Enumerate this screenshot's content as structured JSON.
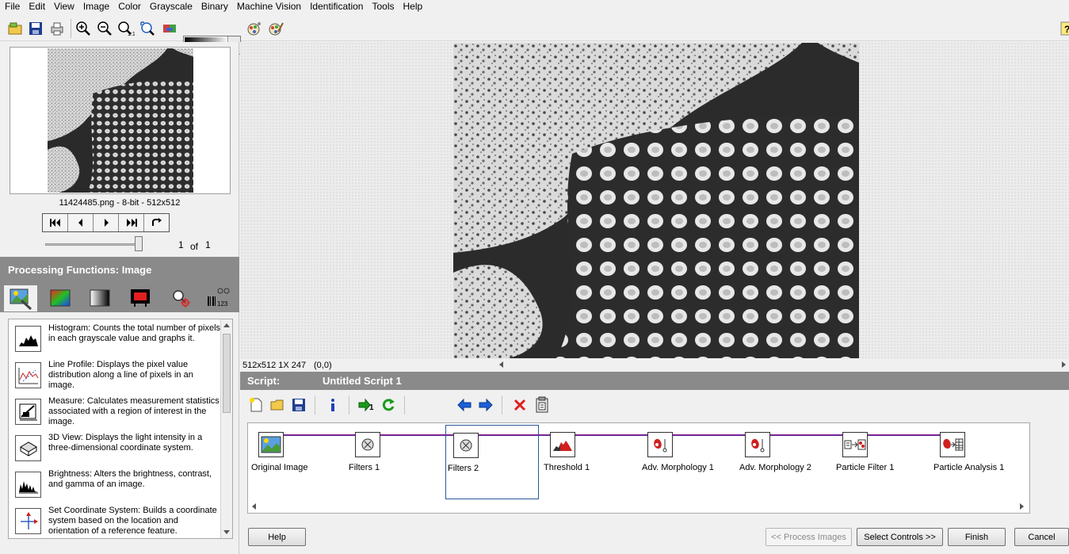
{
  "menu": [
    "File",
    "Edit",
    "View",
    "Image",
    "Color",
    "Grayscale",
    "Binary",
    "Machine Vision",
    "Identification",
    "Tools",
    "Help"
  ],
  "toolbar": {
    "icons": [
      "open-image-icon",
      "save-image-icon",
      "print-icon",
      "zoom-in-icon",
      "zoom-out-icon",
      "zoom-1to1-icon",
      "zoom-fit-icon",
      "image-palette-icon",
      "browse-icon",
      "color-icon"
    ],
    "palette_label": "Grayscale palette"
  },
  "browser": {
    "caption": "11424485.png - 8-bit - 512x512",
    "page_current": "1",
    "page_of": "of",
    "page_total": "1"
  },
  "processing": {
    "title": "Processing Functions: Image",
    "tabs": [
      "image-tab",
      "color-tab",
      "grayscale-tab",
      "binary-tab",
      "machine-vision-tab",
      "identification-tab"
    ],
    "functions": [
      {
        "name": "Histogram",
        "desc": "Histogram:  Counts the total number of pixels in each grayscale value and graphs it."
      },
      {
        "name": "Line Profile",
        "desc": "Line Profile:  Displays the pixel value distribution along a line of pixels in an image."
      },
      {
        "name": "Measure",
        "desc": "Measure:  Calculates measurement statistics associated with a region of interest in the image."
      },
      {
        "name": "3D View",
        "desc": "3D View:  Displays the light intensity in a three-dimensional coordinate system."
      },
      {
        "name": "Brightness",
        "desc": "Brightness:  Alters the brightness, contrast, and gamma of an image."
      },
      {
        "name": "Set Coordinate System",
        "desc": "Set Coordinate System:  Builds a coordinate system based on the location and orientation of a reference feature."
      }
    ]
  },
  "viewer": {
    "status_size": "512x512 1X 247",
    "status_coord": "(0,0)"
  },
  "script": {
    "label": "Script:",
    "name": "Untitled Script 1",
    "steps": [
      "Original Image",
      "Filters 1",
      "Filters 2",
      "Threshold 1",
      "Adv. Morphology 1",
      "Adv. Morphology 2",
      "Particle Filter 1",
      "Particle Analysis 1"
    ],
    "selected_step": "Filters 2"
  },
  "footer": {
    "help": "Help",
    "process_images": "<< Process Images",
    "select_controls": "Select Controls >>",
    "finish": "Finish",
    "cancel": "Cancel"
  },
  "colors": {
    "header_gray": "#8a8a8a",
    "selection_blue": "#2b5797",
    "delete_red": "#e02020",
    "arrow_blue": "#1c5fd6",
    "run_green": "#1a9a1a"
  }
}
